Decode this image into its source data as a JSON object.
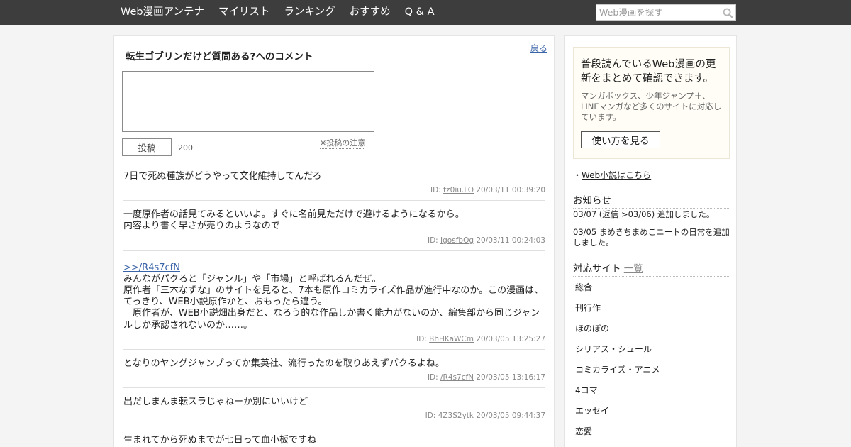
{
  "header": {
    "nav": [
      "Web漫画アンテナ",
      "マイリスト",
      "ランキング",
      "おすすめ",
      "Q & A"
    ],
    "search_placeholder": "Web漫画を探す"
  },
  "main": {
    "back_label": "戻る",
    "title": "転生ゴブリンだけど質問ある?へのコメント",
    "post_button": "投稿",
    "char_limit": "200",
    "post_note": "※投稿の注意",
    "comments": [
      {
        "text": "7日で死ぬ種族がどうやって文化維持してんだろ",
        "id_prefix": "ID: ",
        "id": "tz0iu.LO",
        "date": "20/03/11 00:39:20"
      },
      {
        "text": "一度原作者の話見てみるといいよ。すぐに名前見ただけで避けるようになるから。\n内容より書く早さが売りのようなので",
        "id_prefix": "ID: ",
        "id": "IgosfbOg",
        "date": "20/03/11 00:24:03"
      },
      {
        "reply": ">>/R4s7cfN",
        "text": "みんながパクると「ジャンル」や「市場」と呼ばれるんだぜ。\n原作者「三木なずな」のサイトを見ると、7本も原作コミカライズ作品が進行中なのか。この漫画は、てっきり、WEB小説原作かと、おもったら違う。\n　原作者が、WEB小説畑出身だと、なろう的な作品しか書く能力がないのか、編集部から同じジャンルしか承認されないのか……。",
        "id_prefix": "ID: ",
        "id": "BhHKaWCm",
        "date": "20/03/05 13:25:27"
      },
      {
        "text": "となりのヤングジャンプってか集英社、流行ったのを取りあえずパクるよね。",
        "id_prefix": "ID: ",
        "id": "/R4s7cfN",
        "date": "20/03/05 13:16:17"
      },
      {
        "text": "出だしまんま転スラじゃねーか別にいいけど",
        "id_prefix": "ID: ",
        "id": "4Z3S2ytk",
        "date": "20/03/05 09:44:37"
      },
      {
        "text": "生まれてから死ぬまでが七日って血小板ですね",
        "id_prefix": "ID: ",
        "id": "",
        "date": ""
      }
    ]
  },
  "sidebar": {
    "promo_title": "普段読んでいるWeb漫画の更新をまとめて確認できます。",
    "promo_desc": "マンガボックス、少年ジャンプ＋、LINEマンガなど多くのサイトに対応しています。",
    "howto_button": "使い方を見る",
    "novel_prefix": "・",
    "novel_link": "Web小説はこちら",
    "news_heading": "お知らせ",
    "news": [
      {
        "date": "03/07 ",
        "text": "(返信 >03/06) 追加しました。",
        "link": "",
        "suffix": ""
      },
      {
        "date": "03/05 ",
        "text": "",
        "link": "まめきちまめこニートの日常",
        "suffix": "を追加しました。"
      }
    ],
    "sites_heading": "対応サイト",
    "sites_more": "一覧",
    "sites": [
      "総合",
      "刊行作",
      "ほのぼの",
      "シリアス・シュール",
      "コミカライズ・アニメ",
      "4コマ",
      "エッセイ",
      "恋愛"
    ]
  }
}
